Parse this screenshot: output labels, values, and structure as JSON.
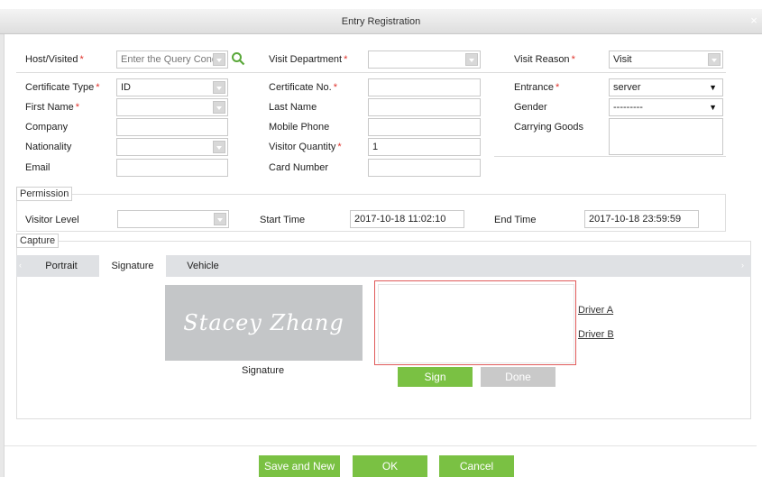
{
  "window": {
    "title": "Entry Registration",
    "close_glyph": "×"
  },
  "visit": {
    "host_visited": {
      "label": "Host/Visited",
      "placeholder": "Enter the Query Condit"
    },
    "visit_department": {
      "label": "Visit Department",
      "value": ""
    },
    "visit_reason": {
      "label": "Visit Reason",
      "value": "Visit"
    }
  },
  "form": {
    "certificate_type": {
      "label": "Certificate Type",
      "value": "ID"
    },
    "certificate_no": {
      "label": "Certificate No.",
      "value": ""
    },
    "entrance": {
      "label": "Entrance",
      "value": "server"
    },
    "first_name": {
      "label": "First Name",
      "value": ""
    },
    "last_name": {
      "label": "Last Name",
      "value": ""
    },
    "gender": {
      "label": "Gender",
      "value": "---------"
    },
    "company": {
      "label": "Company",
      "value": ""
    },
    "mobile_phone": {
      "label": "Mobile Phone",
      "value": ""
    },
    "carrying_goods": {
      "label": "Carrying Goods",
      "value": ""
    },
    "nationality": {
      "label": "Nationality",
      "value": ""
    },
    "visitor_quantity": {
      "label": "Visitor Quantity",
      "value": "1"
    },
    "email": {
      "label": "Email",
      "value": ""
    },
    "card_number": {
      "label": "Card Number",
      "value": ""
    }
  },
  "permission": {
    "section_title": "Permission",
    "visitor_level": {
      "label": "Visitor Level",
      "value": ""
    },
    "start_time": {
      "label": "Start Time",
      "value": "2017-10-18 11:02:10"
    },
    "end_time": {
      "label": "End Time",
      "value": "2017-10-18 23:59:59"
    }
  },
  "capture": {
    "section_title": "Capture",
    "tabs": [
      {
        "label": "Portrait",
        "active": false
      },
      {
        "label": "Signature",
        "active": true
      },
      {
        "label": "Vehicle",
        "active": false
      }
    ],
    "signature_image_text": "Stacey Zhang",
    "signature_caption": "Signature",
    "sign_button": "Sign",
    "done_button": "Done",
    "drivers": [
      "Driver A",
      "Driver B"
    ]
  },
  "footer": {
    "save_and_new": "Save and New",
    "ok": "OK",
    "cancel": "Cancel"
  },
  "required_mark": "*",
  "icons": {
    "search": "search-icon",
    "dropdown": "chevron-down-icon"
  },
  "colors": {
    "accent_green": "#7ac143",
    "required_red": "#e0322b",
    "signature_pad_border": "#e05a5a"
  }
}
